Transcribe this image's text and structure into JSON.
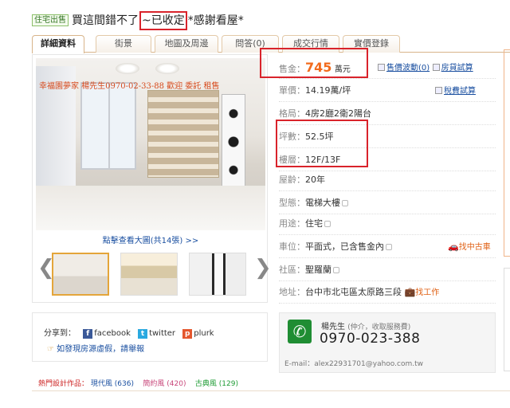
{
  "header": {
    "badge": "住宅出售",
    "title_before": "買這間錯不了",
    "title_highlight": "~已收定",
    "title_after": "*感謝看屋*"
  },
  "tabs": [
    {
      "label": "詳細資料",
      "active": true
    },
    {
      "label": "街景"
    },
    {
      "label": "地圖及周邊"
    },
    {
      "label": "問答(0)"
    },
    {
      "label": "成交行情"
    },
    {
      "label": "實價登錄"
    }
  ],
  "photo": {
    "watermark": "幸福園夢家 楊先生0970-02-33-88 歡迎 委託 租售",
    "view_more": "點擊查看大圖(共14張) >>",
    "prev": "❮",
    "next": "❯"
  },
  "info": {
    "price_label": "售金：",
    "price": "745",
    "price_unit": "萬元",
    "price_link1": "售價波動(0)",
    "price_link2": "房貸試算",
    "unit_price_label": "單價：",
    "unit_price": "14.19萬/坪",
    "unit_price_link": "稅費試算",
    "layout_label": "格局：",
    "layout": "4房2廳2衛2陽台",
    "area_label": "坪數：",
    "area": "52.5坪",
    "floor_label": "樓層：",
    "floor": "12F/13F",
    "age_label": "屋齡：",
    "age": "20年",
    "type_label": "型態：",
    "type": "電梯大樓",
    "usage_label": "用途：",
    "usage": "住宅",
    "parking_label": "車位：",
    "parking": "平面式，已含售金內",
    "parking_link": "找中古車",
    "community_label": "社區：",
    "community": "聖羅蘭",
    "address_label": "地址：",
    "address": "台中市北屯區太原路三段",
    "address_link": "找工作"
  },
  "contact": {
    "name": "楊先生",
    "role": "(仲介，收取服務費)",
    "phone": "0970-023-388",
    "email_label": "E-mail：",
    "email": "alex22931701@yahoo.com.tw"
  },
  "share": {
    "label": "分享到：",
    "facebook": "facebook",
    "twitter": "twitter",
    "plurk": "plurk",
    "report": "如發現房源虛假，請舉報"
  },
  "hot": {
    "label": "熱門設計作品：",
    "item1": "現代風 (636)",
    "item2": "簡約風 (420)",
    "item3": "古典風 (129)"
  },
  "colors": {
    "accent": "#f26b1d",
    "highlight_box": "#d9232b",
    "link": "#1a4fa0",
    "phone_green": "#1f8d33"
  }
}
